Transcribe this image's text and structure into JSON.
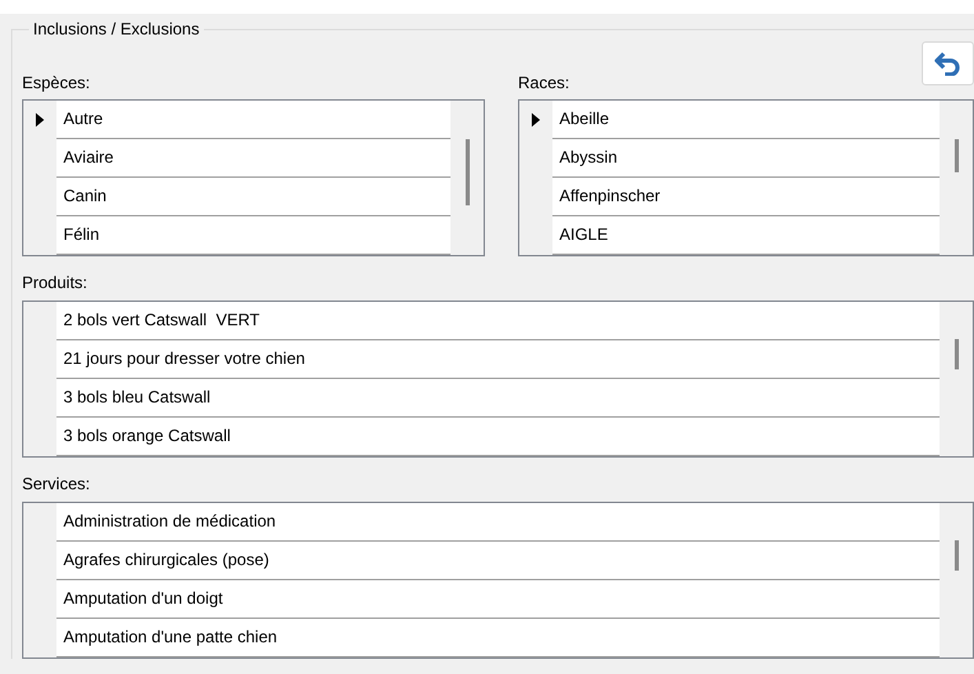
{
  "group": {
    "title": "Inclusions / Exclusions"
  },
  "lists": [
    {
      "label": "Espèces:",
      "rows": [
        {
          "text": "Autre",
          "selected": true
        },
        {
          "text": "Aviaire",
          "selected": false
        },
        {
          "text": "Canin",
          "selected": false
        },
        {
          "text": "Félin",
          "selected": false
        }
      ]
    },
    {
      "label": "Races:",
      "rows": [
        {
          "text": "Abeille",
          "selected": true
        },
        {
          "text": "Abyssin",
          "selected": false
        },
        {
          "text": "Affenpinscher",
          "selected": false
        },
        {
          "text": "AIGLE",
          "selected": false
        }
      ]
    },
    {
      "label": "Produits:",
      "rows": [
        {
          "text": "2 bols vert Catswall  VERT",
          "selected": false
        },
        {
          "text": "21 jours pour dresser votre chien",
          "selected": false
        },
        {
          "text": "3 bols bleu Catswall",
          "selected": false
        },
        {
          "text": "3 bols orange Catswall",
          "selected": false
        }
      ]
    },
    {
      "label": "Services:",
      "rows": [
        {
          "text": "Administration de médication",
          "selected": false
        },
        {
          "text": "Agrafes chirurgicales (pose)",
          "selected": false
        },
        {
          "text": "Amputation d'un doigt",
          "selected": false
        },
        {
          "text": "Amputation d'une patte chien",
          "selected": false
        }
      ]
    }
  ]
}
